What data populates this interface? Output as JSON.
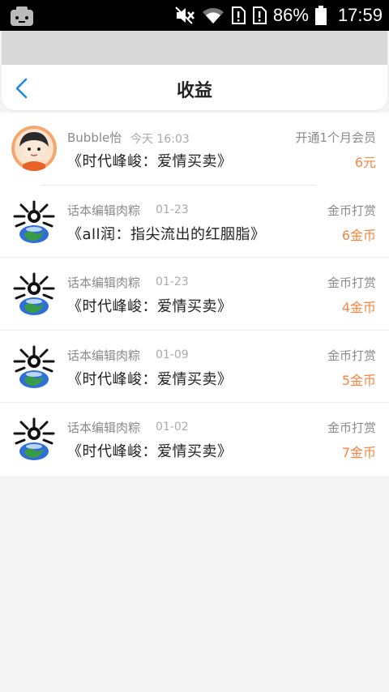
{
  "status_bar": {
    "battery": "86%",
    "time": "17:59"
  },
  "header": {
    "title": "收益"
  },
  "records": [
    {
      "name": "Bubble怡",
      "date": "今天 16:03",
      "book": "《时代峰峻：爱情买卖》",
      "type": "开通1个月会员",
      "amount": "6元",
      "avatar": "cartoon-avatar"
    },
    {
      "name": "话本编辑肉粽",
      "date": "01-23",
      "book": "《all润：指尖流出的红胭脂》",
      "type": "金币打赏",
      "amount": "6金币",
      "avatar": "earth-avatar"
    },
    {
      "name": "话本编辑肉粽",
      "date": "01-23",
      "book": "《时代峰峻：爱情买卖》",
      "type": "金币打赏",
      "amount": "4金币",
      "avatar": "earth-avatar"
    },
    {
      "name": "话本编辑肉粽",
      "date": "01-09",
      "book": "《时代峰峻：爱情买卖》",
      "type": "金币打赏",
      "amount": "5金币",
      "avatar": "earth-avatar"
    },
    {
      "name": "话本编辑肉粽",
      "date": "01-02",
      "book": "《时代峰峻：爱情买卖》",
      "type": "金币打赏",
      "amount": "7金币",
      "avatar": "earth-avatar"
    }
  ],
  "colors": {
    "accent": "#1e88e5",
    "amount": "#f5853f"
  }
}
